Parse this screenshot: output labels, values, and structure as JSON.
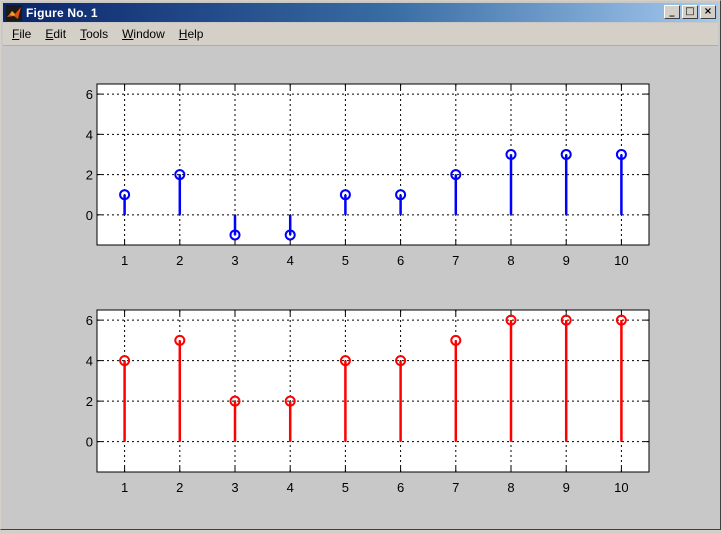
{
  "window": {
    "title": "Figure No. 1",
    "buttons": {
      "minimize": "_",
      "maximize": "□",
      "close": "×"
    }
  },
  "menu": [
    {
      "label": "File",
      "mnemonic": "F",
      "rest": "ile"
    },
    {
      "label": "Edit",
      "mnemonic": "E",
      "rest": "dit"
    },
    {
      "label": "Tools",
      "mnemonic": "T",
      "rest": "ools"
    },
    {
      "label": "Window",
      "mnemonic": "W",
      "rest": "indow"
    },
    {
      "label": "Help",
      "mnemonic": "H",
      "rest": "elp"
    }
  ],
  "chart_data": [
    {
      "type": "stem",
      "x": [
        1,
        2,
        3,
        4,
        5,
        6,
        7,
        8,
        9,
        10
      ],
      "values": [
        1,
        2,
        -1,
        -1,
        1,
        1,
        2,
        3,
        3,
        3
      ],
      "xlim": [
        0.5,
        10.5
      ],
      "ylim": [
        -1.5,
        6.5
      ],
      "xticks": [
        1,
        2,
        3,
        4,
        5,
        6,
        7,
        8,
        9,
        10
      ],
      "yticks": [
        0,
        2,
        4,
        6
      ],
      "grid": true,
      "color": "#0000ff",
      "marker": "circle"
    },
    {
      "type": "stem",
      "x": [
        1,
        2,
        3,
        4,
        5,
        6,
        7,
        8,
        9,
        10
      ],
      "values": [
        4,
        5,
        2,
        2,
        4,
        4,
        5,
        6,
        6,
        6
      ],
      "xlim": [
        0.5,
        10.5
      ],
      "ylim": [
        -1.5,
        6.5
      ],
      "xticks": [
        1,
        2,
        3,
        4,
        5,
        6,
        7,
        8,
        9,
        10
      ],
      "yticks": [
        0,
        2,
        4,
        6
      ],
      "grid": true,
      "color": "#ff0000",
      "marker": "circle"
    }
  ]
}
